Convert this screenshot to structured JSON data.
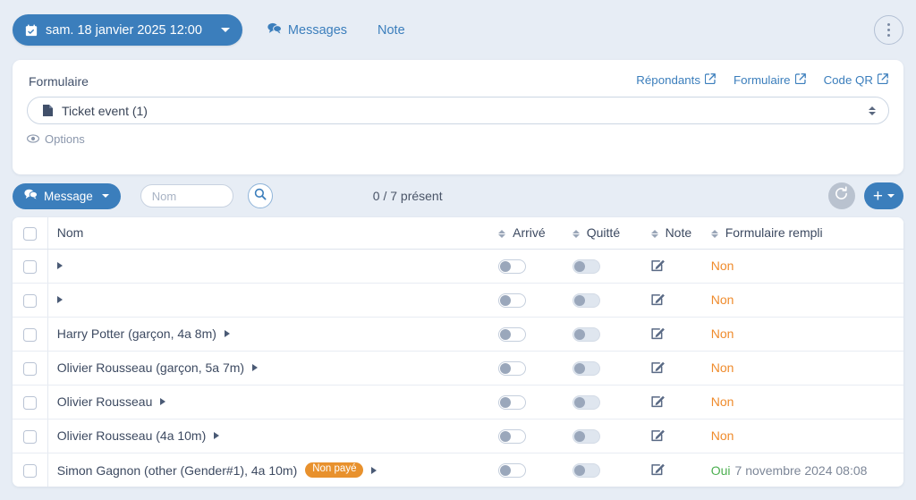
{
  "topbar": {
    "date_label": "sam. 18 janvier 2025 12:00",
    "messages_label": "Messages",
    "note_label": "Note",
    "calendar_icon": "calendar-icon",
    "messages_icon": "chat-bubbles-icon",
    "kebab_icon": "vertical-dots-icon"
  },
  "form_card": {
    "title": "Formulaire",
    "links": [
      {
        "label": "Répondants",
        "icon": "external-link-icon"
      },
      {
        "label": "Formulaire",
        "icon": "external-link-icon"
      },
      {
        "label": "Code QR",
        "icon": "external-link-icon"
      }
    ],
    "select_value": "Ticket event (1)",
    "select_icon": "document-icon",
    "options_label": "Options",
    "options_icon": "eye-icon"
  },
  "toolbar": {
    "message_button": "Message",
    "message_icon": "chat-bubbles-icon",
    "search_placeholder": "Nom",
    "search_value": "",
    "search_icon": "magnifier-icon",
    "present_count": "0 / 7 présent",
    "refresh_icon": "refresh-icon",
    "add_label": "+",
    "add_icon": "plus-icon"
  },
  "table": {
    "headers": {
      "select_all": "",
      "name": "Nom",
      "arrived": "Arrivé",
      "left": "Quitté",
      "note": "Note",
      "form_filled": "Formulaire rempli"
    },
    "rows": [
      {
        "name": "",
        "badge": "",
        "arrived": false,
        "left": false,
        "note_icon": "edit-note-icon",
        "form_filled": "Non",
        "form_date": "",
        "form_state": "no"
      },
      {
        "name": "",
        "badge": "",
        "arrived": false,
        "left": false,
        "note_icon": "edit-note-icon",
        "form_filled": "Non",
        "form_date": "",
        "form_state": "no"
      },
      {
        "name": "Harry Potter (garçon, 4a 8m)",
        "badge": "",
        "arrived": false,
        "left": false,
        "note_icon": "edit-note-icon",
        "form_filled": "Non",
        "form_date": "",
        "form_state": "no"
      },
      {
        "name": "Olivier Rousseau (garçon, 5a 7m)",
        "badge": "",
        "arrived": false,
        "left": false,
        "note_icon": "edit-note-icon",
        "form_filled": "Non",
        "form_date": "",
        "form_state": "no"
      },
      {
        "name": "Olivier Rousseau",
        "badge": "",
        "arrived": false,
        "left": false,
        "note_icon": "edit-note-icon",
        "form_filled": "Non",
        "form_date": "",
        "form_state": "no"
      },
      {
        "name": "Olivier Rousseau (4a 10m)",
        "badge": "",
        "arrived": false,
        "left": false,
        "note_icon": "edit-note-icon",
        "form_filled": "Non",
        "form_date": "",
        "form_state": "no"
      },
      {
        "name": "Simon Gagnon (other (Gender#1), 4a 10m)",
        "badge": "Non payé",
        "arrived": false,
        "left": false,
        "note_icon": "edit-note-icon",
        "form_filled": "Oui",
        "form_date": "7 novembre 2024 08:08",
        "form_state": "yes"
      }
    ]
  },
  "colors": {
    "accent": "#3b7ebc",
    "page_bg": "#e7edf5",
    "badge_orange": "#e8912d",
    "status_no": "#ef8b2c",
    "status_yes": "#4caf50"
  }
}
